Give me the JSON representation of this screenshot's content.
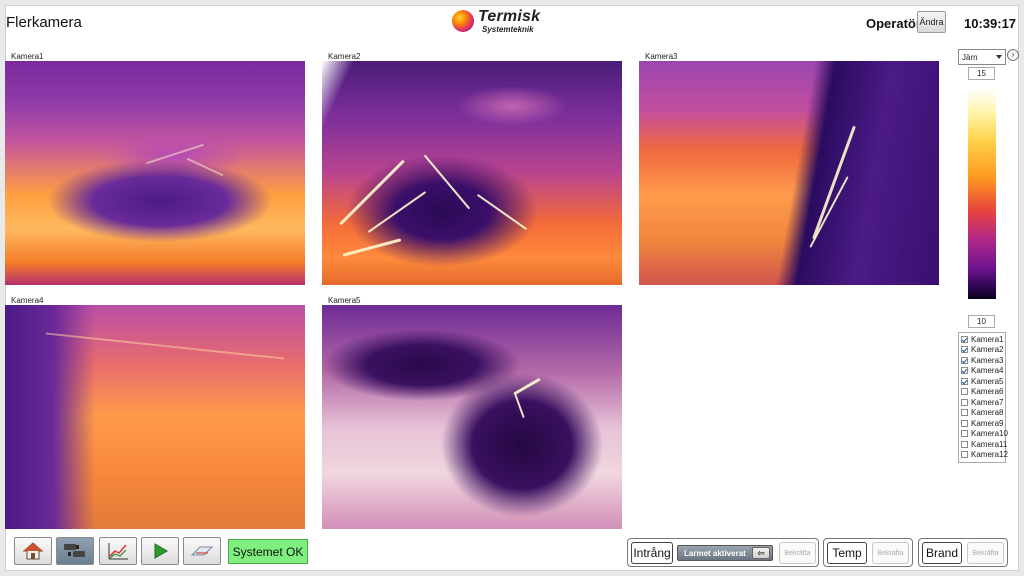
{
  "header": {
    "title": "Flerkamera",
    "logo_name": "Termisk",
    "logo_sub": "Systemteknik",
    "operator_label": "Operatör",
    "change_label": "Ändra",
    "clock": "10:39:17"
  },
  "cameras": [
    {
      "label": "Kamera1"
    },
    {
      "label": "Kamera2"
    },
    {
      "label": "Kamera3"
    },
    {
      "label": "Kamera4"
    },
    {
      "label": "Kamera5"
    }
  ],
  "scale": {
    "palette": "Järn",
    "max": "15",
    "min": "10",
    "colors": [
      "#ffffff",
      "#ffd24a",
      "#ff9a1e",
      "#e8453c",
      "#b0278a",
      "#6b138e",
      "#08011a"
    ]
  },
  "camera_list": [
    {
      "label": "Kamera1",
      "checked": true
    },
    {
      "label": "Kamera2",
      "checked": true
    },
    {
      "label": "Kamera3",
      "checked": true
    },
    {
      "label": "Kamera4",
      "checked": true
    },
    {
      "label": "Kamera5",
      "checked": true
    },
    {
      "label": "Kamera6",
      "checked": false
    },
    {
      "label": "Kamera7",
      "checked": false
    },
    {
      "label": "Kamera8",
      "checked": false
    },
    {
      "label": "Kamera9",
      "checked": false
    },
    {
      "label": "Kamera10",
      "checked": false
    },
    {
      "label": "Kamera11",
      "checked": false
    },
    {
      "label": "Kamera12",
      "checked": false
    }
  ],
  "toolbar": {
    "icons": [
      "home-icon",
      "cameras-icon",
      "chart-icon",
      "play-icon",
      "settings-icon"
    ],
    "status": "Systemet OK",
    "status_color": "#7ff07f"
  },
  "alarms": {
    "intrusion_label": "Intrång",
    "alarm_status": "Larmet aktiverat",
    "ack_label": "Bekräfta",
    "temp_label": "Temp",
    "fire_label": "Brand"
  }
}
